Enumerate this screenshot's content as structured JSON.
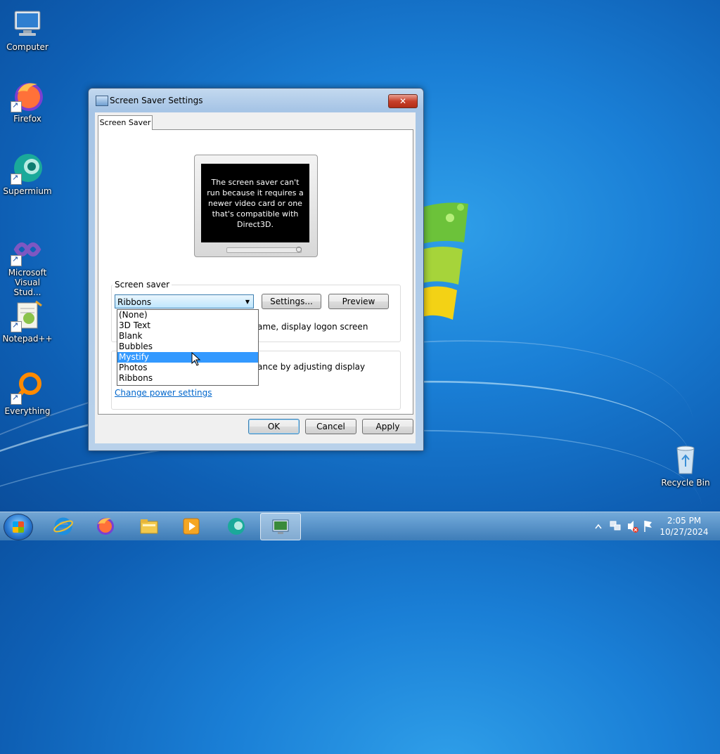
{
  "desktop": {
    "icons": [
      {
        "label": "Computer",
        "icon": "computer-icon"
      },
      {
        "label": "Firefox",
        "icon": "firefox-icon"
      },
      {
        "label": "Supermium",
        "icon": "supermium-icon"
      },
      {
        "label": "Microsoft Visual Stud...",
        "icon": "visual-studio-icon"
      },
      {
        "label": "Notepad++",
        "icon": "notepadpp-icon"
      },
      {
        "label": "Everything",
        "icon": "everything-icon"
      },
      {
        "label": "Recycle Bin",
        "icon": "recycle-bin-icon"
      }
    ]
  },
  "dialog": {
    "title": "Screen Saver Settings",
    "close_label": "✕",
    "tab_label": "Screen Saver",
    "preview_message": "The screen saver can't run because it requires a newer video card or one that's compatible with Direct3D.",
    "screensaver_group_label": "Screen saver",
    "selected_screensaver": "Ribbons",
    "settings_button": "Settings...",
    "preview_button": "Preview",
    "resume_text_partial": "ame, display logon screen",
    "power_text_partial": "ance by adjusting display",
    "power_link": "Change power settings",
    "ok_button": "OK",
    "cancel_button": "Cancel",
    "apply_button": "Apply",
    "dropdown_options": [
      "(None)",
      "3D Text",
      "Blank",
      "Bubbles",
      "Mystify",
      "Photos",
      "Ribbons"
    ],
    "highlighted_option": "Mystify"
  },
  "taskbar": {
    "apps": [
      "internet-explorer-icon",
      "firefox-icon",
      "file-explorer-icon",
      "media-player-icon",
      "supermium-icon",
      "screen-saver-settings-icon"
    ],
    "time": "2:05 PM",
    "date": "10/27/2024"
  },
  "colors": {
    "selection": "#3399ff",
    "link": "#0066cc",
    "close_button": "#c7402a"
  }
}
